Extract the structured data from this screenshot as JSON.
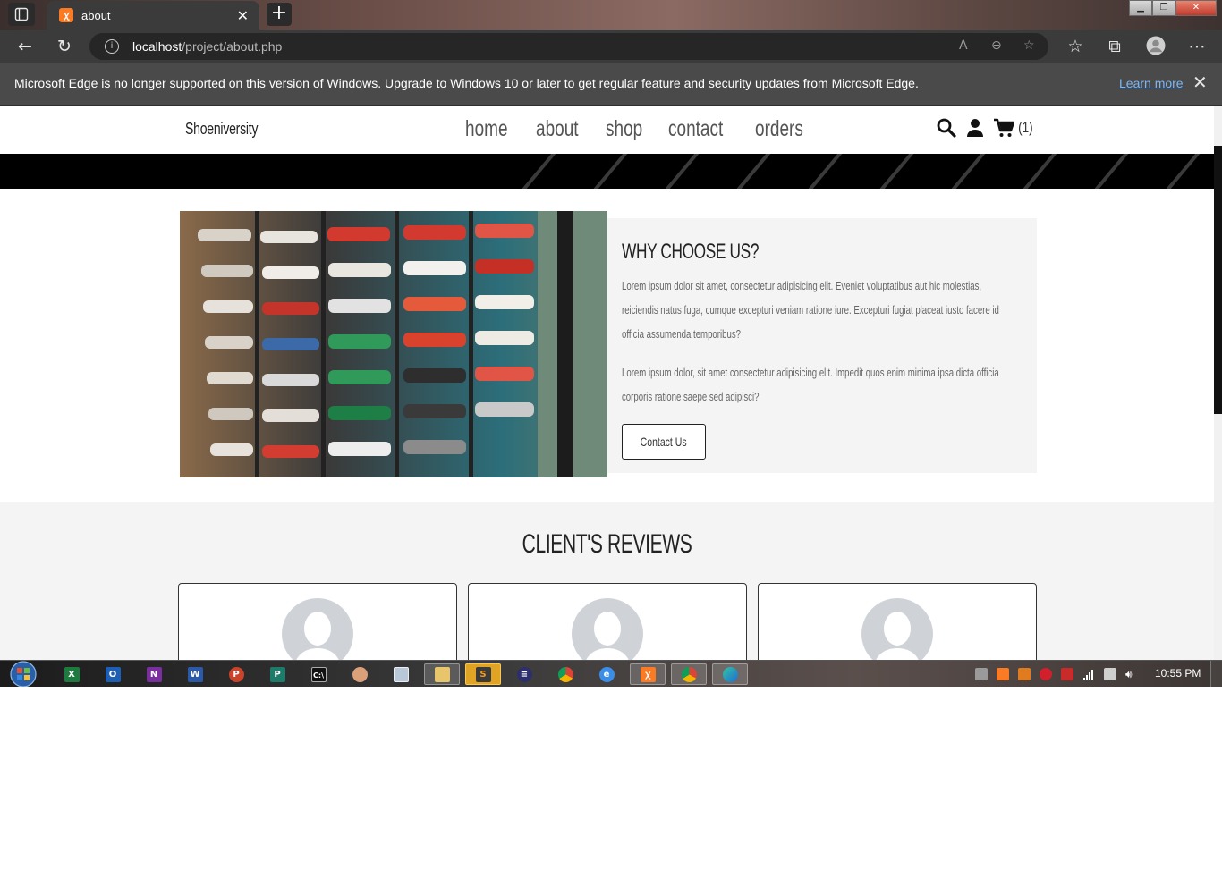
{
  "browser": {
    "tab_title": "about",
    "url_host": "localhost",
    "url_path": "/project/about.php",
    "infobar_message": "Microsoft Edge is no longer supported on this version of Windows. Upgrade to Windows 10 or later to get regular feature and security updates from Microsoft Edge.",
    "infobar_link": "Learn more",
    "accent": "#7cb6f5"
  },
  "site": {
    "brand": "Shoeniversity",
    "nav": [
      "home",
      "about",
      "shop",
      "contact",
      "orders"
    ],
    "cart_count": "(1)"
  },
  "about": {
    "heading": "WHY CHOOSE US?",
    "paragraph_1": "Lorem ipsum dolor sit amet, consectetur adipisicing elit. Eveniet voluptatibus aut hic molestias, reiciendis natus fuga, cumque excepturi veniam ratione iure. Excepturi fugiat placeat iusto facere id officia assumenda temporibus?",
    "paragraph_2": "Lorem ipsum dolor, sit amet consectetur adipisicing elit. Impedit quos enim minima ipsa dicta officia corporis ratione saepe sed adipisci?",
    "button": "Contact Us"
  },
  "reviews": {
    "title": "CLIENT'S REVIEWS"
  },
  "taskbar": {
    "clock": "10:55 PM",
    "apps": [
      "excel",
      "outlook",
      "onenote",
      "word",
      "powerpoint",
      "publisher",
      "cmd",
      "paint",
      "monitor",
      "explorer",
      "sublime",
      "eclipse",
      "chrome",
      "edge-legacy",
      "xampp",
      "chrome-profile",
      "edge"
    ]
  }
}
